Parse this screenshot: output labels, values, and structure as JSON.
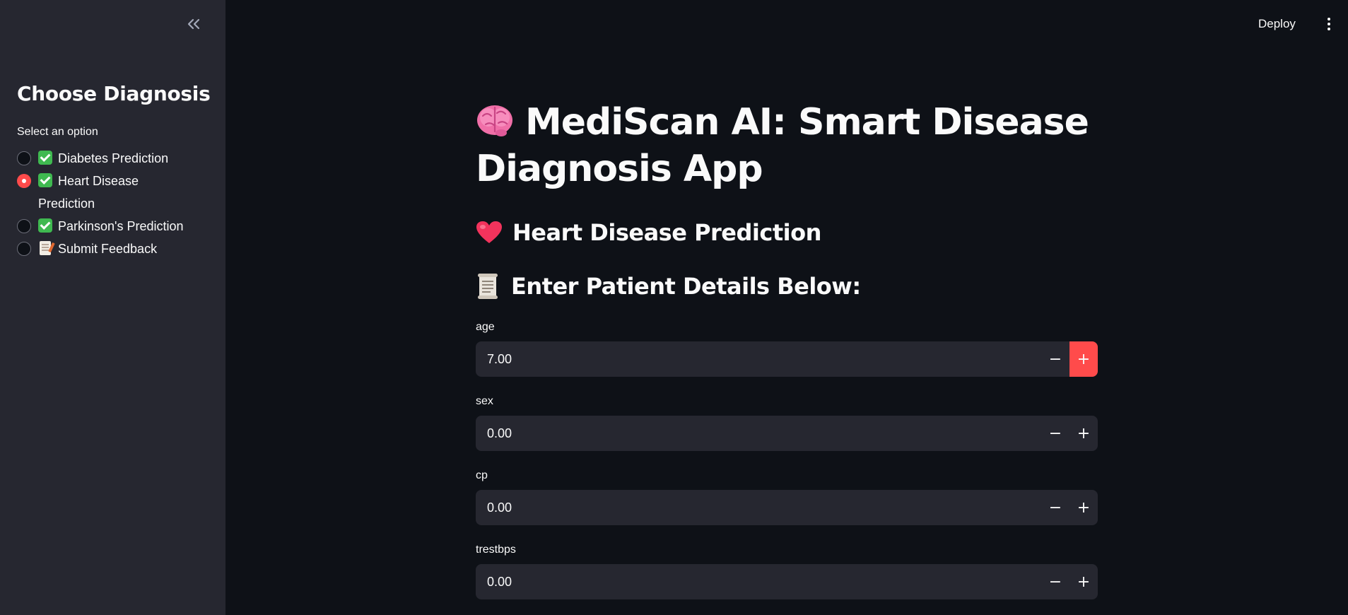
{
  "sidebar": {
    "title": "Choose Diagnosis",
    "caption": "Select an option",
    "options": [
      {
        "label": "Diabetes Prediction",
        "icon": "check-mark-emoji",
        "selected": false
      },
      {
        "label": "Heart Disease Prediction",
        "icon": "check-mark-emoji",
        "selected": true
      },
      {
        "label": "Parkinson's Prediction",
        "icon": "check-mark-emoji",
        "selected": false
      },
      {
        "label": "Submit Feedback",
        "icon": "memo-emoji",
        "selected": false
      }
    ],
    "collapse_icon": "double-chevron-left-icon"
  },
  "topbar": {
    "deploy_label": "Deploy",
    "menu_icon": "vertical-dots-icon"
  },
  "main": {
    "title": "MediScan AI: Smart Disease Diagnosis App",
    "title_icon": "brain-emoji",
    "subheader": "Heart Disease Prediction",
    "subheader_icon": "heart-emoji",
    "details_header": "Enter Patient Details Below:",
    "details_icon": "scroll-emoji",
    "fields": [
      {
        "label": "age",
        "value": "7.00"
      },
      {
        "label": "sex",
        "value": "0.00"
      },
      {
        "label": "cp",
        "value": "0.00"
      },
      {
        "label": "trestbps",
        "value": "0.00"
      }
    ]
  },
  "colors": {
    "background": "#0e1117",
    "sidebar": "#262730",
    "accent": "#ff4b4b",
    "input_bg": "#262730",
    "text": "#fafafa"
  }
}
